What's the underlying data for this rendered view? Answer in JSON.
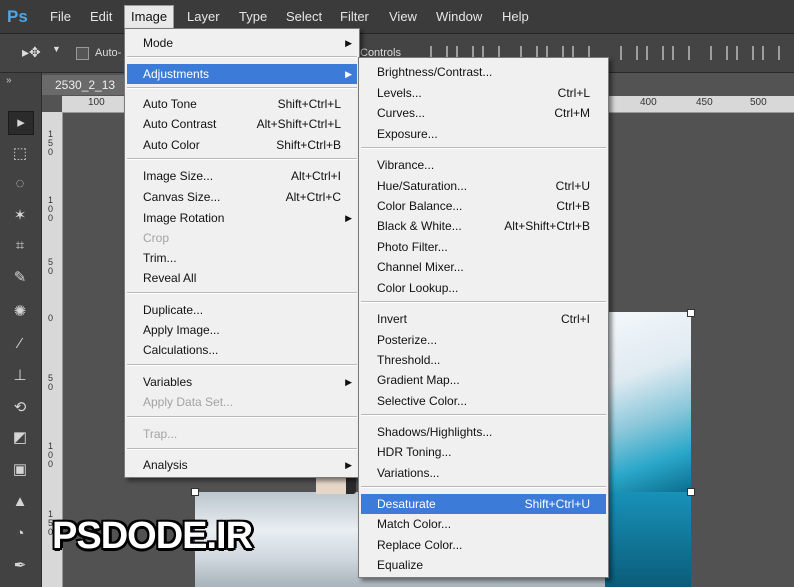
{
  "app": {
    "logo": "Ps"
  },
  "menubar": [
    "File",
    "Edit",
    "Image",
    "Layer",
    "Type",
    "Select",
    "Filter",
    "View",
    "Window",
    "Help"
  ],
  "options": {
    "auto_select": "Auto-",
    "controls_label": "Controls"
  },
  "document": {
    "tab": "2530_2_13"
  },
  "ruler_h": [
    "100",
    "400",
    "450",
    "500"
  ],
  "ruler_v": [
    "150",
    "100",
    "50",
    "0",
    "50",
    "100",
    "150"
  ],
  "image_menu": [
    {
      "label": "Mode",
      "shortcut": "",
      "arrow": true
    },
    {
      "label": "Adjustments",
      "shortcut": "",
      "arrow": true,
      "highlighted": true
    },
    {
      "label": "Auto Tone",
      "shortcut": "Shift+Ctrl+L"
    },
    {
      "label": "Auto Contrast",
      "shortcut": "Alt+Shift+Ctrl+L"
    },
    {
      "label": "Auto Color",
      "shortcut": "Shift+Ctrl+B"
    },
    {
      "label": "Image Size...",
      "shortcut": "Alt+Ctrl+I"
    },
    {
      "label": "Canvas Size...",
      "shortcut": "Alt+Ctrl+C"
    },
    {
      "label": "Image Rotation",
      "shortcut": "",
      "arrow": true
    },
    {
      "label": "Crop",
      "shortcut": "",
      "disabled": true
    },
    {
      "label": "Trim...",
      "shortcut": ""
    },
    {
      "label": "Reveal All",
      "shortcut": ""
    },
    {
      "label": "Duplicate...",
      "shortcut": ""
    },
    {
      "label": "Apply Image...",
      "shortcut": ""
    },
    {
      "label": "Calculations...",
      "shortcut": ""
    },
    {
      "label": "Variables",
      "shortcut": "",
      "arrow": true
    },
    {
      "label": "Apply Data Set...",
      "shortcut": "",
      "disabled": true
    },
    {
      "label": "Trap...",
      "shortcut": "",
      "disabled": true
    },
    {
      "label": "Analysis",
      "shortcut": "",
      "arrow": true
    }
  ],
  "adjustments_menu": [
    {
      "label": "Brightness/Contrast...",
      "shortcut": ""
    },
    {
      "label": "Levels...",
      "shortcut": "Ctrl+L"
    },
    {
      "label": "Curves...",
      "shortcut": "Ctrl+M"
    },
    {
      "label": "Exposure...",
      "shortcut": ""
    },
    {
      "label": "Vibrance...",
      "shortcut": ""
    },
    {
      "label": "Hue/Saturation...",
      "shortcut": "Ctrl+U"
    },
    {
      "label": "Color Balance...",
      "shortcut": "Ctrl+B"
    },
    {
      "label": "Black & White...",
      "shortcut": "Alt+Shift+Ctrl+B"
    },
    {
      "label": "Photo Filter...",
      "shortcut": ""
    },
    {
      "label": "Channel Mixer...",
      "shortcut": ""
    },
    {
      "label": "Color Lookup...",
      "shortcut": ""
    },
    {
      "label": "Invert",
      "shortcut": "Ctrl+I"
    },
    {
      "label": "Posterize...",
      "shortcut": ""
    },
    {
      "label": "Threshold...",
      "shortcut": ""
    },
    {
      "label": "Gradient Map...",
      "shortcut": ""
    },
    {
      "label": "Selective Color...",
      "shortcut": ""
    },
    {
      "label": "Shadows/Highlights...",
      "shortcut": ""
    },
    {
      "label": "HDR Toning...",
      "shortcut": ""
    },
    {
      "label": "Variations...",
      "shortcut": ""
    },
    {
      "label": "Desaturate",
      "shortcut": "Shift+Ctrl+U",
      "highlighted": true
    },
    {
      "label": "Match Color...",
      "shortcut": ""
    },
    {
      "label": "Replace Color...",
      "shortcut": ""
    },
    {
      "label": "Equalize",
      "shortcut": ""
    }
  ],
  "watermark": "PSDODE.IR",
  "colors": {
    "highlight": "#3d7bd8",
    "menubar": "#3b3b3b",
    "workspace": "#535353",
    "logo": "#4ea6e8"
  }
}
